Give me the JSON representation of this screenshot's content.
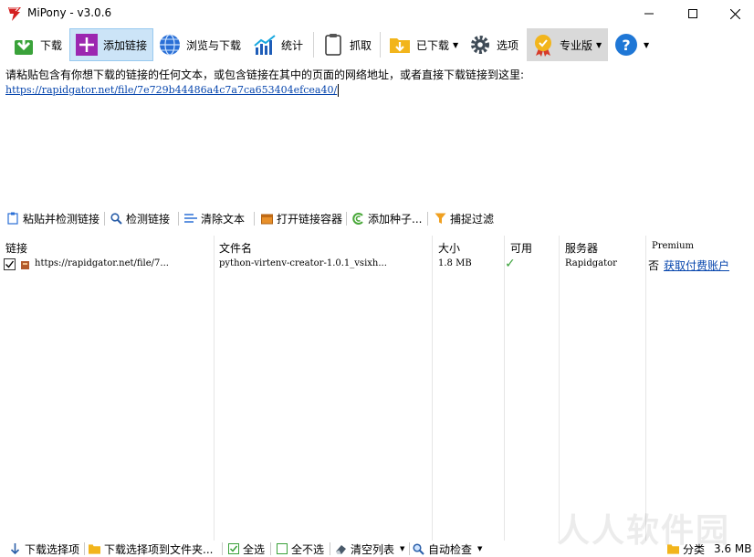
{
  "window": {
    "title": "MiPony - v3.0.6"
  },
  "toolbar": {
    "download": "下载",
    "add_link": "添加链接",
    "browse_download": "浏览与下载",
    "stats": "统计",
    "grab": "抓取",
    "downloaded": "已下载",
    "options": "选项",
    "pro": "专业版"
  },
  "paste": {
    "prompt": "请粘贴包含有你想下载的链接的任何文本，或包含链接在其中的页面的网络地址，或者直接下载链接到这里:",
    "value": "https://rapidgator.net/file/7e729b44486a4c7a7ca653404efcea40/"
  },
  "subbar": {
    "paste_check": "粘贴并检测链接",
    "check_links": "检测链接",
    "clear_text": "清除文本",
    "open_container": "打开链接容器",
    "add_torrent": "添加种子...",
    "capture_filter": "捕捉过滤"
  },
  "table": {
    "columns": [
      "链接",
      "文件名",
      "大小",
      "可用",
      "服务器",
      "Premium"
    ],
    "rows": [
      {
        "link": "https://rapidgator.net/file/7...",
        "filename": "python-virtenv-creator-1.0.1_vsixh...",
        "size": "1.8 MB",
        "available": "✓",
        "server": "Rapidgator",
        "premium": "否",
        "premium_link": "获取付费账户"
      }
    ]
  },
  "bottombar": {
    "download_selected": "下载选择项",
    "download_to_folder": "下载选择项到文件夹...",
    "select_all": "全选",
    "select_none": "全不选",
    "clear_list": "清空列表",
    "auto_check": "自动检查",
    "category": "分类",
    "total_size": "3.6 MB"
  },
  "watermark": "人人软件园",
  "colors": {
    "link": "#0645ad",
    "active_button": "#cce4f7",
    "pro_button": "#d9d9d9",
    "check_green": "#3aa23a"
  }
}
